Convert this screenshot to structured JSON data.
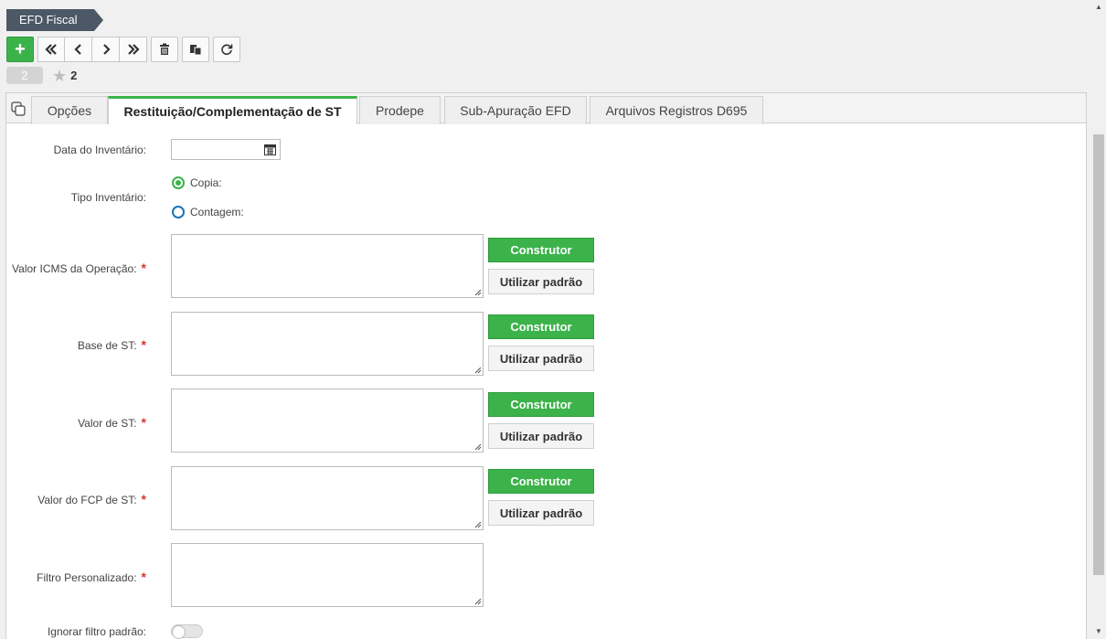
{
  "breadcrumb": {
    "title": "EFD Fiscal"
  },
  "toolbar": {
    "buttons": [
      {
        "name": "add",
        "icon": "plus-icon"
      },
      {
        "name": "first",
        "icon": "double-chevron-left-icon"
      },
      {
        "name": "previous",
        "icon": "chevron-left-icon"
      },
      {
        "name": "next",
        "icon": "chevron-right-icon"
      },
      {
        "name": "last",
        "icon": "double-chevron-right-icon"
      },
      {
        "name": "delete",
        "icon": "trash-icon"
      },
      {
        "name": "copy",
        "icon": "copy-icon"
      },
      {
        "name": "refresh",
        "icon": "refresh-icon"
      }
    ]
  },
  "record": {
    "badge": "2",
    "favorite_count": "2"
  },
  "tabs": [
    {
      "label": "Opções",
      "active": false
    },
    {
      "label": "Restituição/Complementação de ST",
      "active": true
    },
    {
      "label": "Prodepe",
      "active": false
    },
    {
      "label": "Sub-Apuração EFD",
      "active": false
    },
    {
      "label": "Arquivos Registros D695",
      "active": false
    }
  ],
  "form": {
    "data_inventario": {
      "label": "Data do Inventário:",
      "value": ""
    },
    "tipo_inventario": {
      "label": "Tipo Inventário:",
      "options": [
        {
          "label": "Copia:",
          "selected": true
        },
        {
          "label": "Contagem:",
          "selected": false
        }
      ]
    },
    "valor_icms": {
      "label": "Valor ICMS da Operação:",
      "required": "*",
      "value": ""
    },
    "base_st": {
      "label": "Base de ST:",
      "required": "*",
      "value": ""
    },
    "valor_st": {
      "label": "Valor de ST:",
      "required": "*",
      "value": ""
    },
    "valor_fcp": {
      "label": "Valor do FCP de ST:",
      "required": "*",
      "value": ""
    },
    "filtro": {
      "label": "Filtro Personalizado:",
      "required": "*",
      "value": ""
    },
    "ignorar_filtro": {
      "label": "Ignorar filtro padrão:",
      "on": false
    },
    "construtor_label": "Construtor",
    "utilizar_label": "Utilizar padrão"
  },
  "colors": {
    "accent": "#3cb34a",
    "radio_blue": "#1a73b5",
    "required": "#d9342b",
    "breadcrumb_bg": "#4d5866"
  }
}
